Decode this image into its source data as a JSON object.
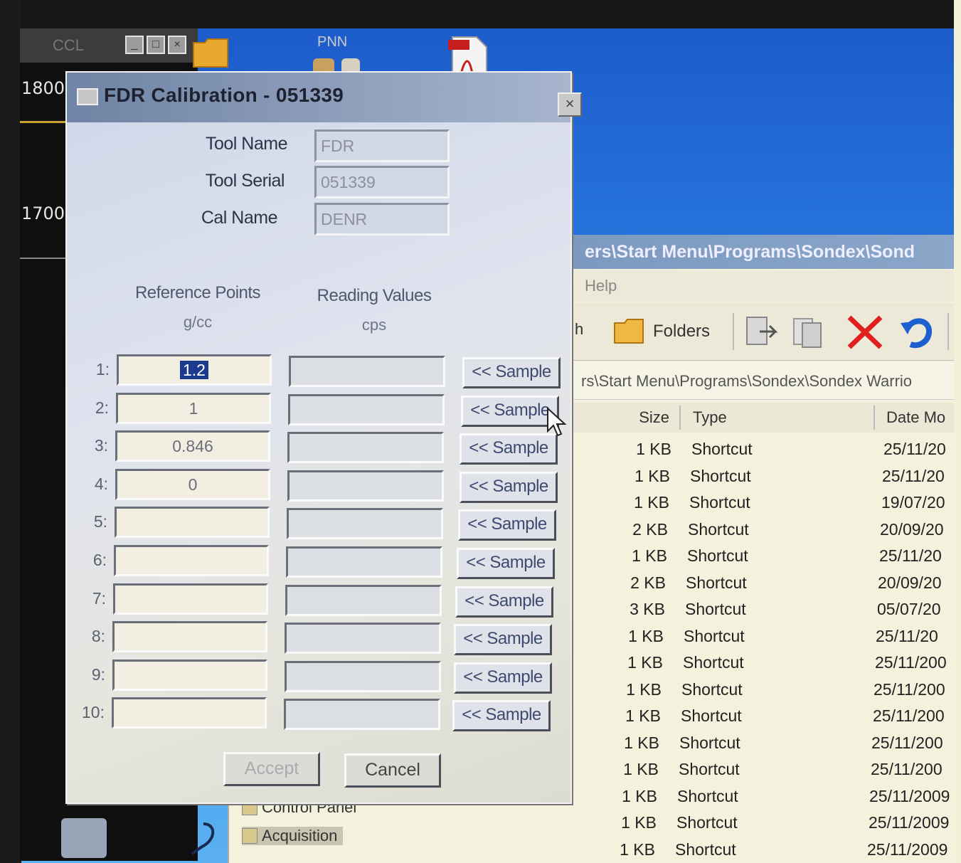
{
  "background_app": {
    "title": "CCL",
    "scale_labels": [
      "1800",
      "1700"
    ]
  },
  "desktop": {
    "icon_label_pnn": "PNN"
  },
  "explorer": {
    "title": "ers\\Start Menu\\Programs\\Sondex\\Sond",
    "menu_help": "Help",
    "toolbar_partial": "h",
    "folders_label": "Folders",
    "address": "rs\\Start Menu\\Programs\\Sondex\\Sondex Warrio",
    "columns": {
      "size": "Size",
      "type": "Type",
      "date": "Date Mo"
    },
    "rows": [
      {
        "size": "1 KB",
        "type": "Shortcut",
        "date": "25/11/20"
      },
      {
        "size": "1 KB",
        "type": "Shortcut",
        "date": "25/11/20"
      },
      {
        "size": "1 KB",
        "type": "Shortcut",
        "date": "19/07/20"
      },
      {
        "size": "2 KB",
        "type": "Shortcut",
        "date": "20/09/20"
      },
      {
        "size": "1 KB",
        "type": "Shortcut",
        "date": "25/11/20"
      },
      {
        "size": "2 KB",
        "type": "Shortcut",
        "date": "20/09/20"
      },
      {
        "size": "3 KB",
        "type": "Shortcut",
        "date": "05/07/20"
      },
      {
        "size": "1 KB",
        "type": "Shortcut",
        "date": "25/11/20"
      },
      {
        "size": "1 KB",
        "type": "Shortcut",
        "date": "25/11/200"
      },
      {
        "size": "1 KB",
        "type": "Shortcut",
        "date": "25/11/200"
      },
      {
        "size": "1 KB",
        "type": "Shortcut",
        "date": "25/11/200"
      },
      {
        "size": "1 KB",
        "type": "Shortcut",
        "date": "25/11/200"
      },
      {
        "size": "1 KB",
        "type": "Shortcut",
        "date": "25/11/200"
      },
      {
        "size": "1 KB",
        "type": "Shortcut",
        "date": "25/11/2009"
      },
      {
        "size": "1 KB",
        "type": "Shortcut",
        "date": "25/11/2009"
      },
      {
        "size": "1 KB",
        "type": "Shortcut",
        "date": "25/11/2009"
      }
    ],
    "lower_items": [
      "Control Panel",
      "Acquisition"
    ]
  },
  "dialog": {
    "title": "FDR Calibration - 051339",
    "close_glyph": "×",
    "tool_name_label": "Tool Name",
    "tool_name_value": "FDR",
    "tool_serial_label": "Tool Serial",
    "tool_serial_value": "051339",
    "cal_name_label": "Cal Name",
    "cal_name_value": "DENR",
    "ref_header": "Reference Points",
    "ref_unit": "g/cc",
    "read_header": "Reading Values",
    "read_unit": "cps",
    "rows": [
      {
        "num": "1:",
        "ref": "1.2",
        "reading": "",
        "sample": "<< Sample"
      },
      {
        "num": "2:",
        "ref": "1",
        "reading": "",
        "sample": "<< Sample"
      },
      {
        "num": "3:",
        "ref": "0.846",
        "reading": "",
        "sample": "<< Sample"
      },
      {
        "num": "4:",
        "ref": "0",
        "reading": "",
        "sample": "<< Sample"
      },
      {
        "num": "5:",
        "ref": "",
        "reading": "",
        "sample": "<< Sample"
      },
      {
        "num": "6:",
        "ref": "",
        "reading": "",
        "sample": "<< Sample"
      },
      {
        "num": "7:",
        "ref": "",
        "reading": "",
        "sample": "<< Sample"
      },
      {
        "num": "8:",
        "ref": "",
        "reading": "",
        "sample": "<< Sample"
      },
      {
        "num": "9:",
        "ref": "",
        "reading": "",
        "sample": "<< Sample"
      },
      {
        "num": "10:",
        "ref": "",
        "reading": "",
        "sample": "<< Sample"
      }
    ],
    "accept_label": "Accept",
    "cancel_label": "Cancel"
  },
  "colors": {
    "desktop_blue": "#2a7be0",
    "dialog_title": "#7f92b2",
    "selection": "#1c3a8e",
    "delete_red": "#e0201c",
    "undo_blue": "#1e5fd0"
  }
}
